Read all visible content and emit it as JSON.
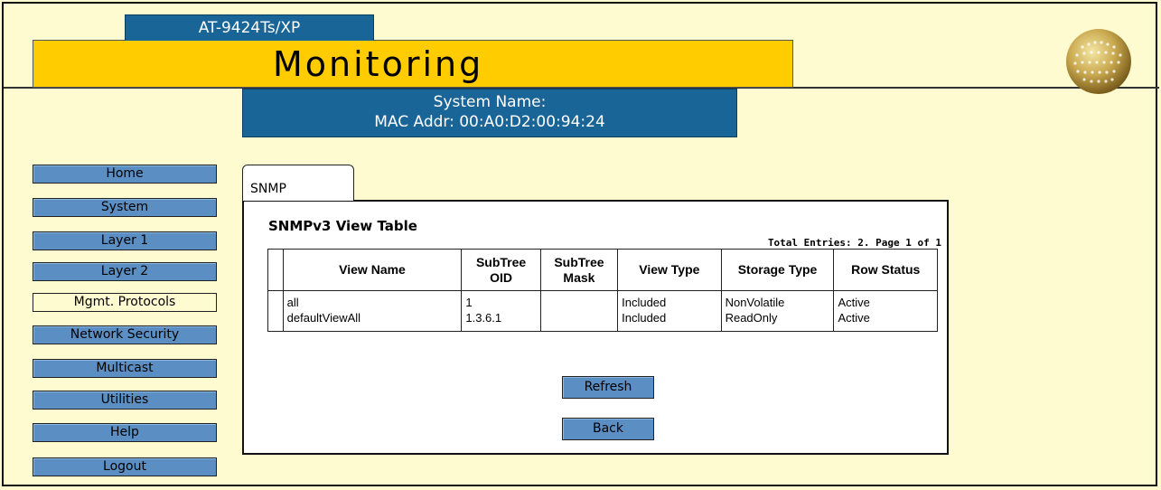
{
  "header": {
    "model": "AT-9424Ts/XP",
    "title": "Monitoring",
    "system_name_label": "System Name:",
    "mac_label": "MAC Addr: 00:A0:D2:00:94:24"
  },
  "nav": {
    "items": [
      {
        "label": "Home"
      },
      {
        "label": "System"
      },
      {
        "label": "Layer 1"
      },
      {
        "label": "Layer 2"
      },
      {
        "label": "Mgmt. Protocols"
      },
      {
        "label": "Network Security"
      },
      {
        "label": "Multicast"
      },
      {
        "label": "Utilities"
      },
      {
        "label": "Help"
      },
      {
        "label": "Logout"
      }
    ],
    "active": "Mgmt. Protocols"
  },
  "content": {
    "tab": "SNMP",
    "table_title": "SNMPv3 View Table",
    "total_entries": "Total Entries: 2. Page 1 of 1",
    "columns": [
      "View Name",
      "SubTree OID",
      "SubTree Mask",
      "View Type",
      "Storage Type",
      "Row Status"
    ],
    "rows": [
      [
        "all",
        "1",
        "",
        "Included",
        "NonVolatile",
        "Active"
      ],
      [
        "defaultViewAll",
        "1.3.6.1",
        "",
        "Included",
        "ReadOnly",
        "Active"
      ]
    ],
    "refresh_label": "Refresh",
    "back_label": "Back"
  },
  "colors": {
    "background": "#fffbd0",
    "header_yellow": "#ffcc00",
    "header_blue": "#1a6598",
    "button_blue": "#5b8fc4"
  },
  "icons": {
    "logo": "globe-icon"
  }
}
